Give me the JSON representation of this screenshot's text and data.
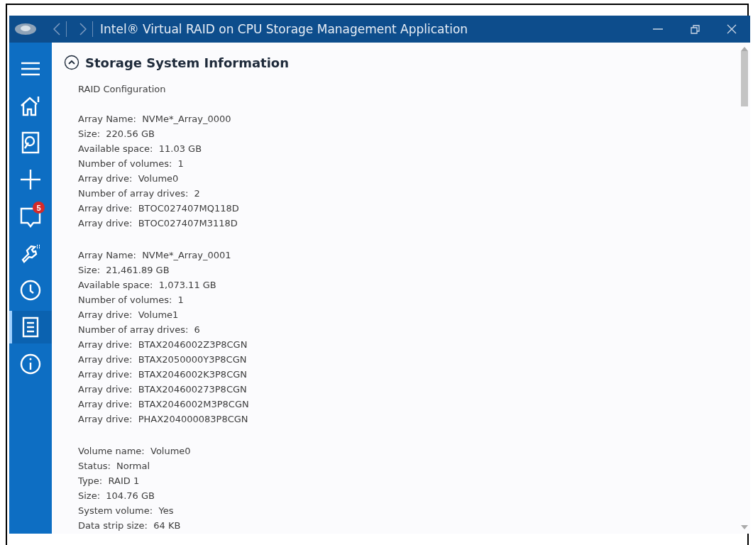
{
  "window": {
    "title": "Intel® Virtual RAID on CPU Storage Management Application"
  },
  "sidebar": {
    "items": [
      {
        "kind": "menu",
        "selected": false
      },
      {
        "kind": "home",
        "selected": false
      },
      {
        "kind": "disk",
        "selected": false
      },
      {
        "kind": "plus",
        "selected": false
      },
      {
        "kind": "notifications",
        "selected": false,
        "badge": "5"
      },
      {
        "kind": "tools",
        "selected": false
      },
      {
        "kind": "clock",
        "selected": false
      },
      {
        "kind": "document",
        "selected": true
      },
      {
        "kind": "info",
        "selected": false
      }
    ]
  },
  "section": {
    "title": "Storage System Information",
    "expanded": true,
    "subtitle": "RAID Configuration",
    "groups": [
      [
        "Array Name:  NVMe*_Array_0000",
        "Size:  220.56 GB",
        "Available space:  11.03 GB",
        "Number of volumes:  1",
        "Array drive:  Volume0",
        "Number of array drives:  2",
        "Array drive:  BTOC027407MQ118D",
        "Array drive:  BTOC027407M3118D"
      ],
      [
        "Array Name:  NVMe*_Array_0001",
        "Size:  21,461.89 GB",
        "Available space:  1,073.11 GB",
        "Number of volumes:  1",
        "Array drive:  Volume1",
        "Number of array drives:  6",
        "Array drive:  BTAX2046002Z3P8CGN",
        "Array drive:  BTAX2050000Y3P8CGN",
        "Array drive:  BTAX2046002K3P8CGN",
        "Array drive:  BTAX204600273P8CGN",
        "Array drive:  BTAX2046002M3P8CGN",
        "Array drive:  PHAX204000083P8CGN"
      ],
      [
        "Volume name:  Volume0",
        "Status:  Normal",
        "Type:  RAID 1",
        "Size:  104.76 GB",
        "System volume:  Yes",
        "Data strip size:  64 KB"
      ]
    ]
  }
}
